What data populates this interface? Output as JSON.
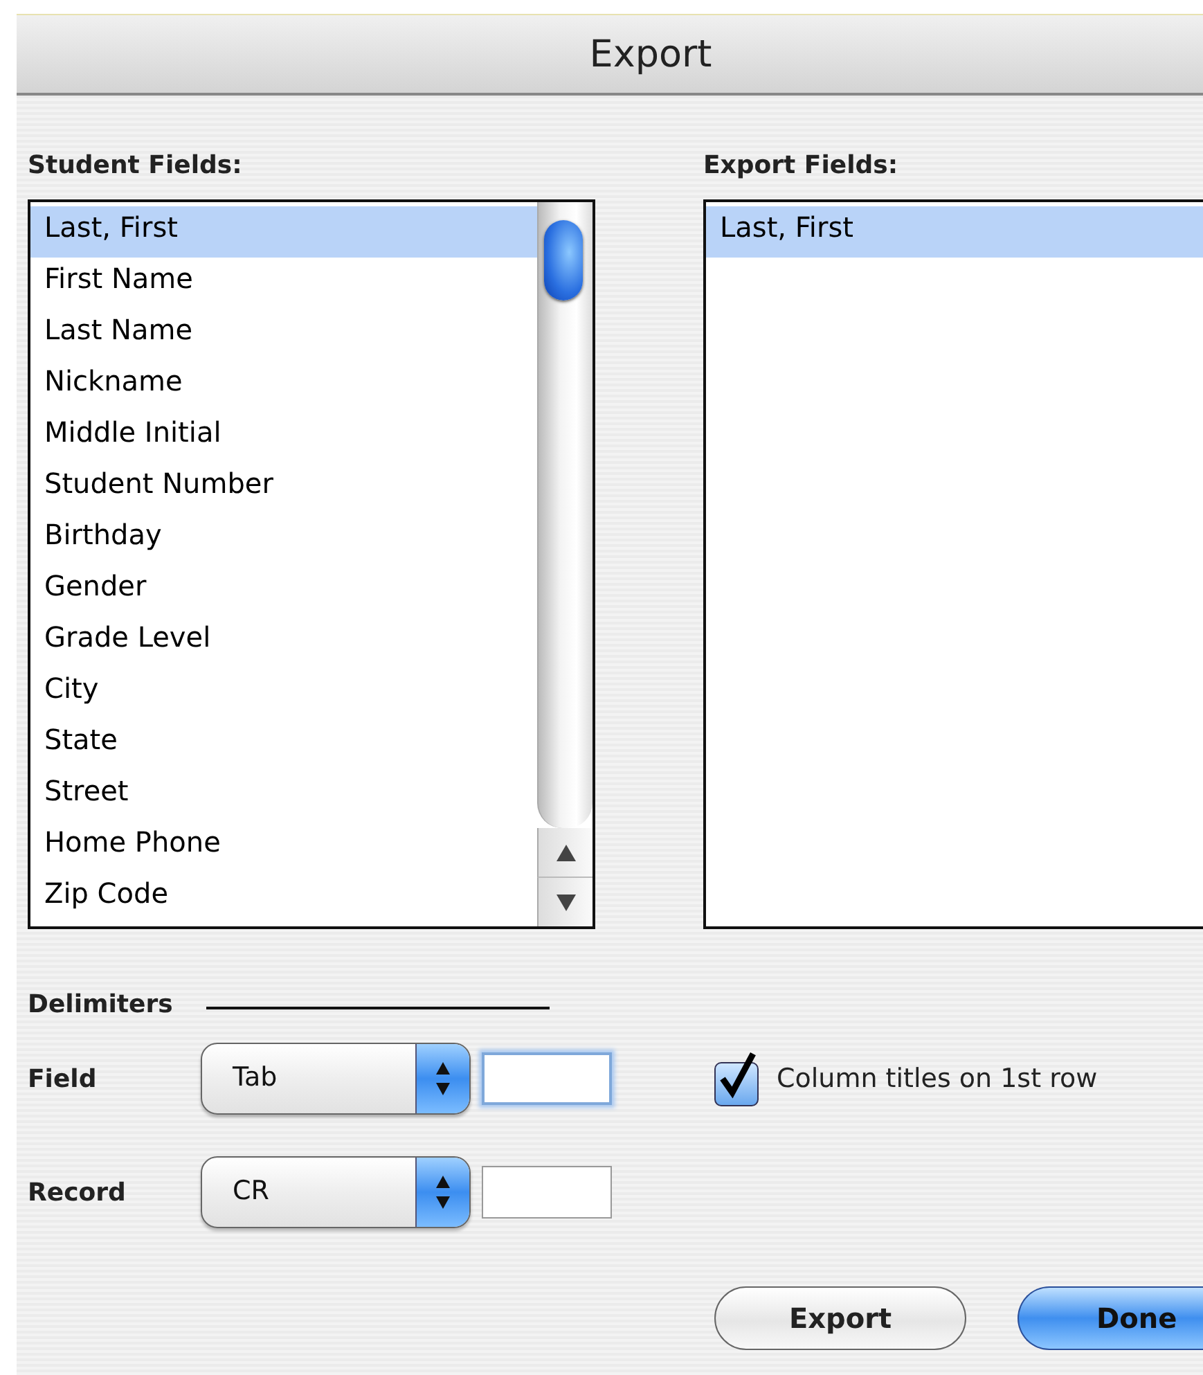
{
  "window": {
    "title": "Export"
  },
  "student_fields": {
    "label": "Student Fields:",
    "items": [
      {
        "label": "Last, First",
        "selected": true
      },
      {
        "label": "First Name",
        "selected": false
      },
      {
        "label": "Last Name",
        "selected": false
      },
      {
        "label": "Nickname",
        "selected": false
      },
      {
        "label": "Middle Initial",
        "selected": false
      },
      {
        "label": "Student Number",
        "selected": false
      },
      {
        "label": "Birthday",
        "selected": false
      },
      {
        "label": "Gender",
        "selected": false
      },
      {
        "label": "Grade Level",
        "selected": false
      },
      {
        "label": "City",
        "selected": false
      },
      {
        "label": "State",
        "selected": false
      },
      {
        "label": "Street",
        "selected": false
      },
      {
        "label": "Home Phone",
        "selected": false
      },
      {
        "label": "Zip Code",
        "selected": false
      }
    ]
  },
  "export_fields": {
    "label": "Export Fields:",
    "items": [
      {
        "label": "Last, First",
        "selected": true
      }
    ]
  },
  "delimiters": {
    "label": "Delimiters",
    "rows": [
      {
        "label": "Field",
        "popup": "Tab",
        "focused": true
      },
      {
        "label": "Record",
        "popup": "CR",
        "focused": false
      }
    ]
  },
  "column_titles": {
    "label": "Column titles on 1st row",
    "checked": true
  },
  "buttons": [
    {
      "label": "Export",
      "default": false
    },
    {
      "label": "Done",
      "default": true
    }
  ]
}
